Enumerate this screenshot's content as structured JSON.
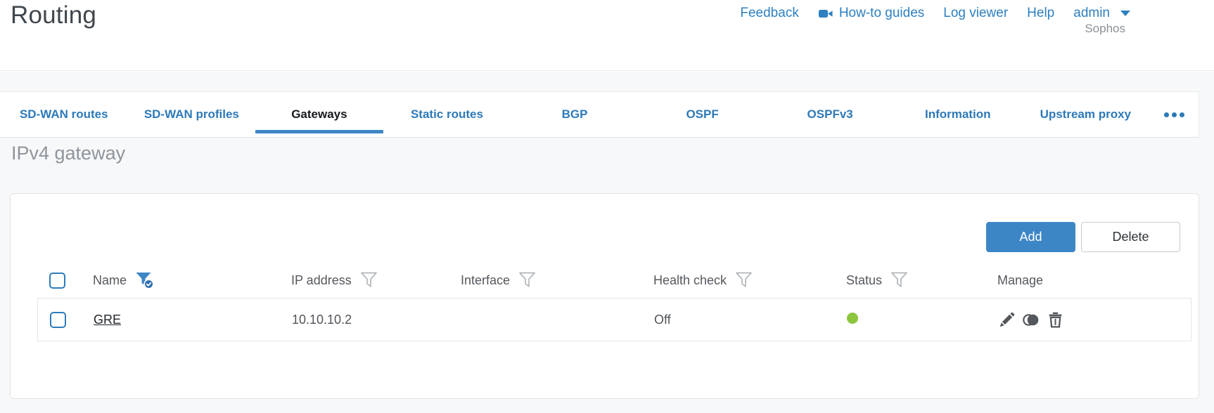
{
  "page": {
    "title": "Routing"
  },
  "header": {
    "links": [
      {
        "label": "Feedback"
      },
      {
        "label": "How-to guides",
        "icon": "video-camera-icon"
      },
      {
        "label": "Log viewer"
      },
      {
        "label": "Help"
      }
    ],
    "user": {
      "name": "admin",
      "icon": "caret-down-icon"
    },
    "brand": "Sophos"
  },
  "tabs": {
    "items": [
      {
        "label": "SD-WAN routes"
      },
      {
        "label": "SD-WAN profiles"
      },
      {
        "label": "Gateways"
      },
      {
        "label": "Static routes"
      },
      {
        "label": "BGP"
      },
      {
        "label": "OSPF"
      },
      {
        "label": "OSPFv3"
      },
      {
        "label": "Information"
      },
      {
        "label": "Upstream proxy"
      }
    ],
    "active": "Gateways",
    "more_icon": "ellipsis-icon"
  },
  "section": {
    "title": "IPv4 gateway"
  },
  "toolbar": {
    "add_label": "Add",
    "delete_label": "Delete"
  },
  "table": {
    "select_all_checked": false,
    "columns": [
      {
        "label": "Name",
        "filter": true,
        "filter_active": true
      },
      {
        "label": "IP address",
        "filter": true,
        "filter_active": false
      },
      {
        "label": "Interface",
        "filter": true,
        "filter_active": false
      },
      {
        "label": "Health check",
        "filter": true,
        "filter_active": false
      },
      {
        "label": "Status",
        "filter": true,
        "filter_active": false
      },
      {
        "label": "Manage",
        "filter": false,
        "filter_active": false
      }
    ],
    "rows": [
      {
        "checked": false,
        "name": "GRE",
        "ip_address": "10.10.10.2",
        "interface": "",
        "health_check": "Off",
        "status": "up-green",
        "manage_icons": [
          "edit-pencil-icon",
          "clone-icon",
          "trash-icon"
        ]
      }
    ]
  },
  "colors": {
    "accent_blue": "#2e80c0",
    "button_blue": "#3d86c6",
    "status_green": "#8cc63f",
    "background_gray": "#f7f8f9"
  }
}
